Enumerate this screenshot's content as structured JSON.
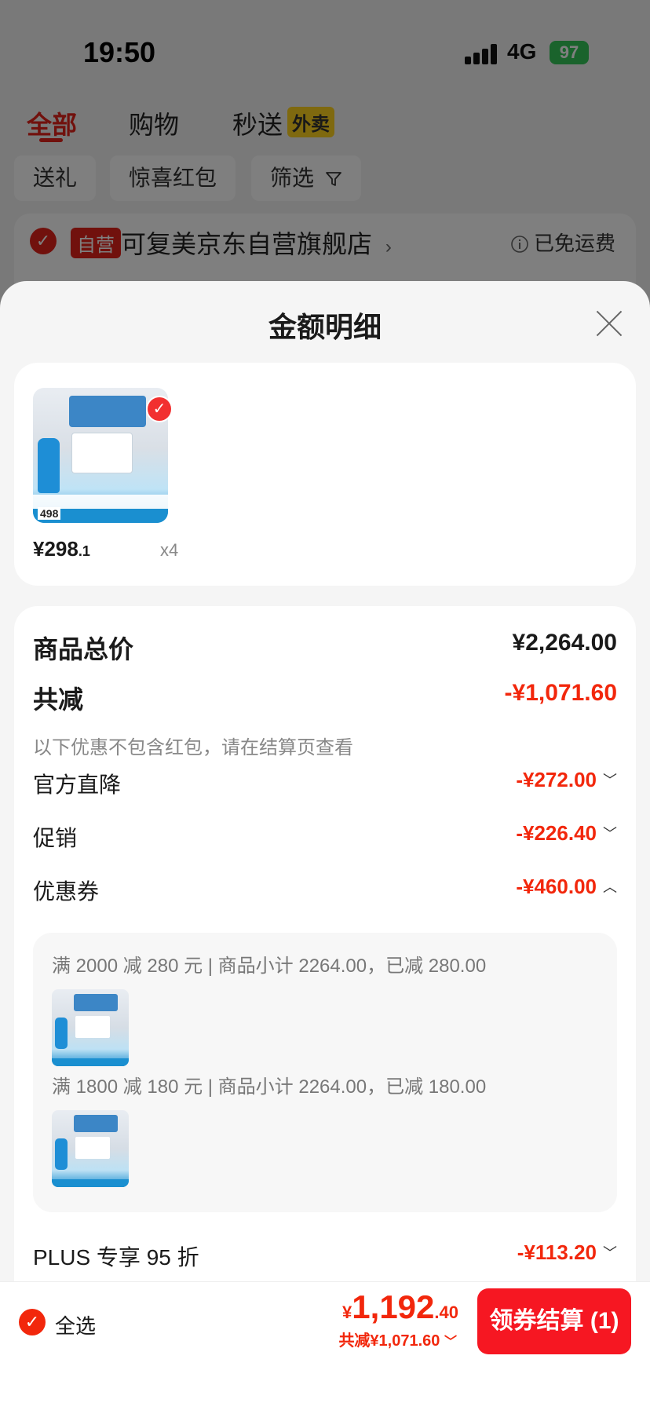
{
  "status_bar": {
    "time": "19:50",
    "network": "4G",
    "battery": "97"
  },
  "background": {
    "tabs": [
      {
        "label": "全部"
      },
      {
        "label": "购物"
      },
      {
        "label": "秒送"
      }
    ],
    "takeout_badge": "外卖",
    "chips": [
      "送礼",
      "惊喜红包",
      "筛选"
    ],
    "store": {
      "badge": "自营",
      "name": "可复美京东自营旗舰店",
      "shipping": "已免运费"
    }
  },
  "sheet": {
    "title": "金额明细",
    "item": {
      "thumb_price": "498",
      "price_main": "¥298",
      "price_decimal": ".1",
      "quantity": "x4"
    },
    "summary": {
      "total_label": "商品总价",
      "total_value": "¥2,264.00",
      "discount_label": "共减",
      "discount_value": "-¥1,071.60",
      "hint": "以下优惠不包含红包，请在结算页查看"
    },
    "lines": [
      {
        "label": "官方直降",
        "value": "-¥272.00",
        "expanded": false
      },
      {
        "label": "促销",
        "value": "-¥226.40",
        "expanded": false
      },
      {
        "label": "优惠券",
        "value": "-¥460.00",
        "expanded": true
      }
    ],
    "coupons": [
      {
        "text": "满 2000 减 280 元 | 商品小计 2264.00，已减 280.00"
      },
      {
        "text": "满 1800 减 180 元 | 商品小计 2264.00，已减 180.00"
      }
    ],
    "plus": {
      "label": "PLUS 专享 95 折",
      "value": "-¥113.20"
    }
  },
  "bottom_bar": {
    "select_all": "全选",
    "total_yen": "¥",
    "total_int": "1,192",
    "total_dec": ".40",
    "saved": "共减¥1,071.60",
    "checkout": "领券结算 (1)"
  },
  "colors": {
    "accent_red": "#f2270c",
    "button_red": "#f61722"
  }
}
